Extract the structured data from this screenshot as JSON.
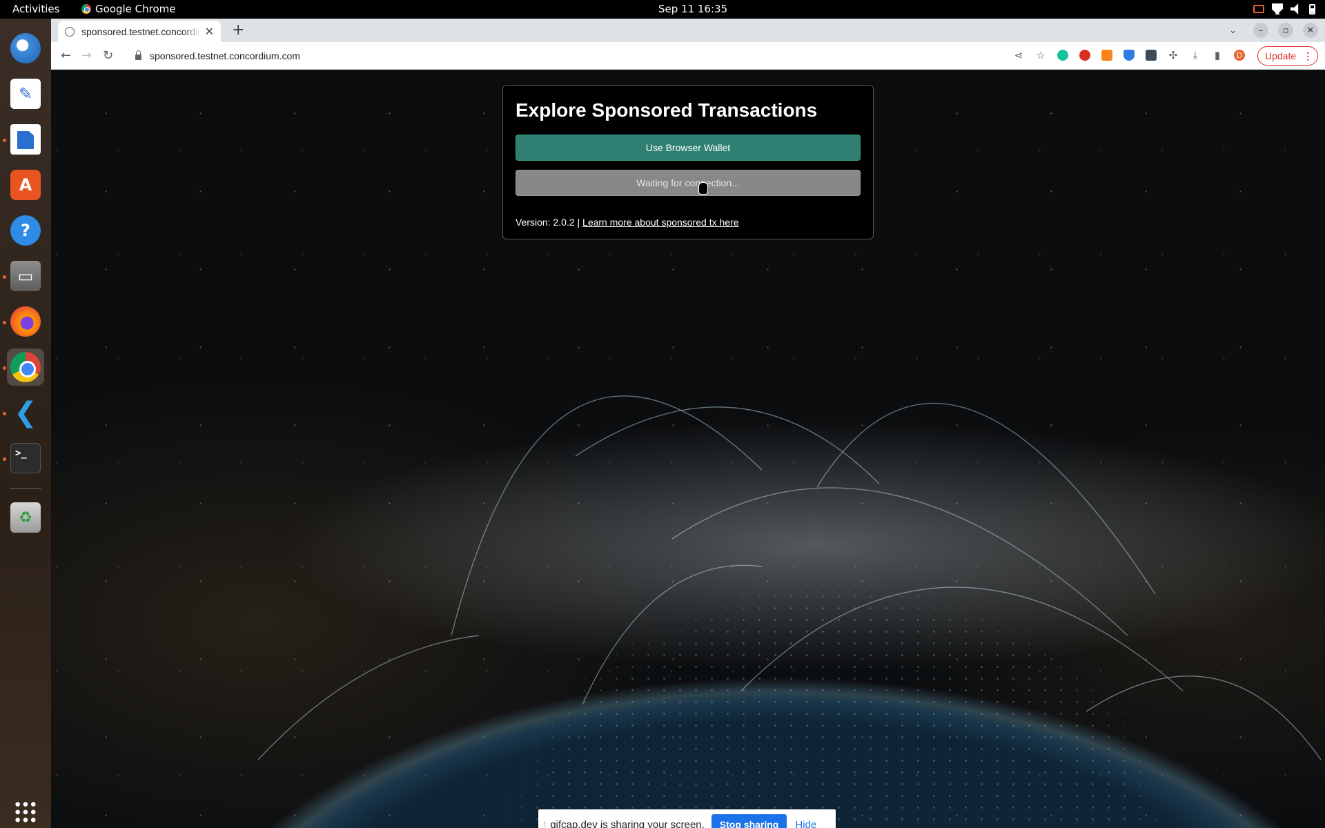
{
  "topbar": {
    "activities": "Activities",
    "app_name": "Google Chrome",
    "clock": "Sep 11  16:35"
  },
  "dock": {
    "apps": [
      "Thunderbird",
      "Text Editor",
      "LibreOffice Writer",
      "Ubuntu Software",
      "Help",
      "Files",
      "Firefox",
      "Google Chrome",
      "Visual Studio Code",
      "Terminal",
      "Trash"
    ],
    "active_app": "Google Chrome"
  },
  "browser": {
    "tab_title": "sponsored.testnet.concordium.com",
    "url": "sponsored.testnet.concordium.com",
    "profile_initial": "D",
    "update_label": "Update",
    "accent_color": "#d93025"
  },
  "page": {
    "title": "Explore Sponsored Transactions",
    "wallet_button": "Use Browser Wallet",
    "waiting_button": "Waiting for connection...",
    "version_text": "Version: 2.0.2 |",
    "learn_more_link": "Learn more about sponsored tx here",
    "wallet_button_color": "#2f8073",
    "waiting_button_color": "#888888"
  },
  "sharebar": {
    "message": "gifcap.dev is sharing your screen.",
    "stop_label": "Stop sharing",
    "hide_label": "Hide"
  }
}
